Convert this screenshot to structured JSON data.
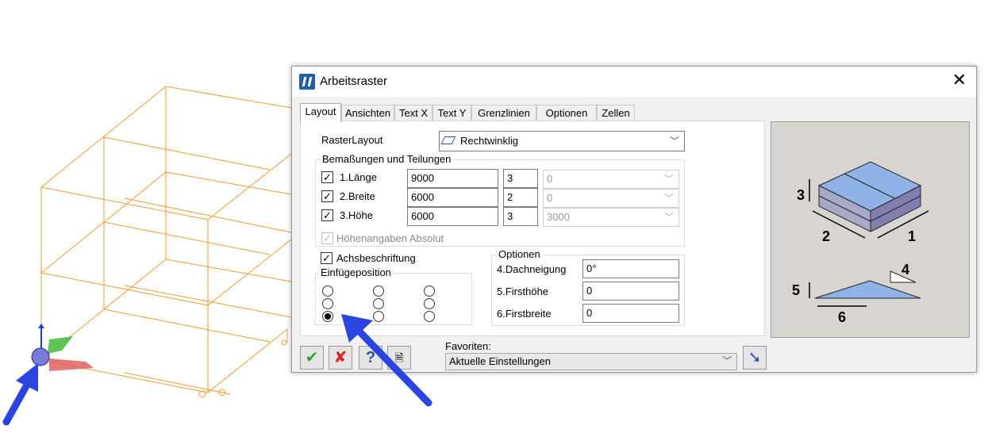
{
  "window": {
    "title": "Arbeitsraster"
  },
  "tabs": [
    "Layout",
    "Ansichten",
    "Text X",
    "Text Y",
    "Grenzlinien",
    "Optionen",
    "Zellen"
  ],
  "raster_layout": {
    "label": "RasterLayout",
    "value": "Rechtwinklig"
  },
  "dimensions": {
    "group_title": "Bemaßungen und Teilungen",
    "rows": [
      {
        "label": "1.Länge",
        "checked": true,
        "value": "9000",
        "divisions": "3",
        "extra": "0"
      },
      {
        "label": "2.Breite",
        "checked": true,
        "value": "6000",
        "divisions": "2",
        "extra": "0"
      },
      {
        "label": "3.Höhe",
        "checked": true,
        "value": "6000",
        "divisions": "3",
        "extra": "3000"
      }
    ],
    "absolute_label": "Höhenangaben Absolut"
  },
  "axis_labeling": {
    "label": "Achsbeschriftung",
    "checked": true
  },
  "insert_position": {
    "title": "Einfügeposition",
    "selected_index": 6
  },
  "options": {
    "title": "Optionen",
    "fields": [
      {
        "label": "4.Dachneigung",
        "value": "0°"
      },
      {
        "label": "5.Firsthöhe",
        "value": "0"
      },
      {
        "label": "6.Firstbreite",
        "value": "0"
      }
    ]
  },
  "preview": {
    "labels": [
      "1",
      "2",
      "3",
      "4",
      "5",
      "6"
    ]
  },
  "favorites": {
    "label": "Favoriten:",
    "value": "Aktuelle Einstellungen"
  },
  "colors": {
    "grid": "#f29a2e",
    "arrow": "#2a44e0",
    "preview_bg": "#d8d4cf",
    "roof": "#8fb3e6"
  }
}
